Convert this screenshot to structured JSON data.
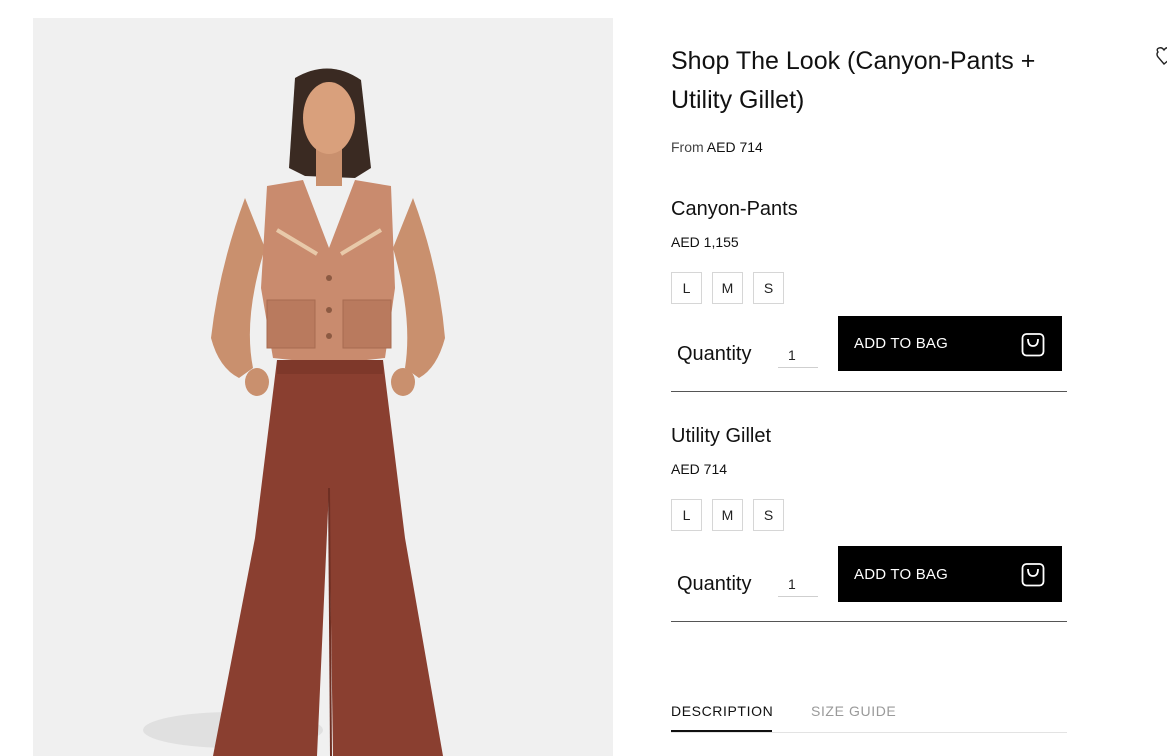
{
  "product": {
    "title": "Shop The Look (Canyon-Pants + Utility Gillet)",
    "from_label": "From",
    "from_price": "AED 714"
  },
  "items": [
    {
      "name": "Canyon-Pants",
      "price": "AED 1,155",
      "sizes": [
        "L",
        "M",
        "S"
      ],
      "quantity_label": "Quantity",
      "quantity": "1",
      "add_label": "ADD TO BAG"
    },
    {
      "name": "Utility Gillet",
      "price": "AED 714",
      "sizes": [
        "L",
        "M",
        "S"
      ],
      "quantity_label": "Quantity",
      "quantity": "1",
      "add_label": "ADD TO BAG"
    }
  ],
  "tabs": {
    "description": "DESCRIPTION",
    "size_guide": "SIZE GUIDE"
  },
  "icons": {
    "bag": "shopping-bag-icon",
    "wishlist": "heart-icon"
  },
  "colors": {
    "button_bg": "#000000",
    "gallery_bg": "#f0f0f0",
    "vest": "#c98b6e",
    "pants": "#8a3f30"
  }
}
